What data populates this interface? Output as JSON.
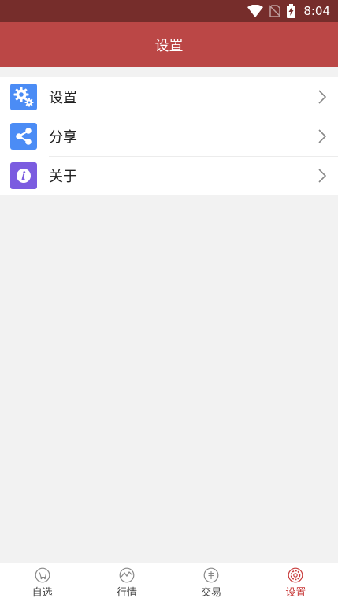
{
  "status_bar": {
    "time": "8:04",
    "icons": [
      "wifi-icon",
      "no-sim-icon",
      "battery-charging-icon"
    ]
  },
  "header": {
    "title": "设置"
  },
  "menu": {
    "items": [
      {
        "label": "设置",
        "icon": "gears-icon",
        "color": "#4b8cf5"
      },
      {
        "label": "分享",
        "icon": "share-icon",
        "color": "#4b8cf5"
      },
      {
        "label": "关于",
        "icon": "info-icon",
        "color": "#7b5ce0"
      }
    ]
  },
  "tabs": {
    "active_index": 3,
    "active_color": "#c83b3a",
    "items": [
      {
        "label": "自选",
        "icon": "cart-icon"
      },
      {
        "label": "行情",
        "icon": "market-chart-icon"
      },
      {
        "label": "交易",
        "icon": "trade-icon"
      },
      {
        "label": "设置",
        "icon": "settings-icon"
      }
    ]
  },
  "colors": {
    "status_bar": "#762d2b",
    "header": "#bb4746",
    "background": "#f2f2f2"
  }
}
